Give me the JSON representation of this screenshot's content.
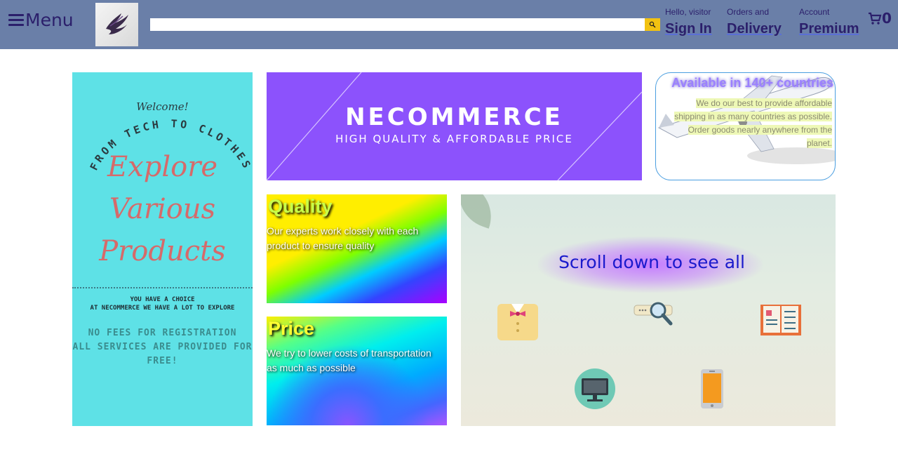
{
  "header": {
    "menu_label": "Menu",
    "logo_name": "site-logo",
    "search": {
      "placeholder": "",
      "value": ""
    },
    "nav": [
      {
        "small": "Hello, visitor",
        "big": "Sign In"
      },
      {
        "small": "Orders and",
        "big": "Delivery"
      },
      {
        "small": "Account",
        "big": "Premium"
      }
    ],
    "cart_count": "0"
  },
  "welcome": {
    "greeting": "Welcome!",
    "arc_text": "FROM TECH TO CLOTHES",
    "explore_lines": [
      "Explore",
      "Various",
      "Products"
    ],
    "choice_lines": [
      "YOU HAVE A CHOICE",
      "AT NECOMMERCE WE HAVE A LOT TO EXPLORE"
    ],
    "fees_lines": [
      "NO FEES FOR REGISTRATION",
      "ALL SERVICES ARE PROVIDED FOR",
      "FREE!"
    ]
  },
  "banner": {
    "name": "NECOMMERCE",
    "tagline": "HIGH QUALITY & AFFORDABLE PRICE"
  },
  "availability": {
    "title": "Available in 140+ countries",
    "lines": [
      "We do our best to provide affordable",
      "shipping in as many countries as possible.",
      "Order goods nearly anywhere from the",
      "planet."
    ]
  },
  "quality": {
    "title": "Quality",
    "text": "Our experts work closely with each product to ensure quality"
  },
  "price": {
    "title": "Price",
    "text": "We try to lower costs of transportation as much as possible"
  },
  "scroll": {
    "text": "Scroll down to see all"
  },
  "colors": {
    "header_bg": "#6a7fa8",
    "header_text": "#2b1f6b",
    "banner_bg": "#8c52fc",
    "welcome_bg": "#5ee1e6",
    "search_button": "#f2c211"
  }
}
